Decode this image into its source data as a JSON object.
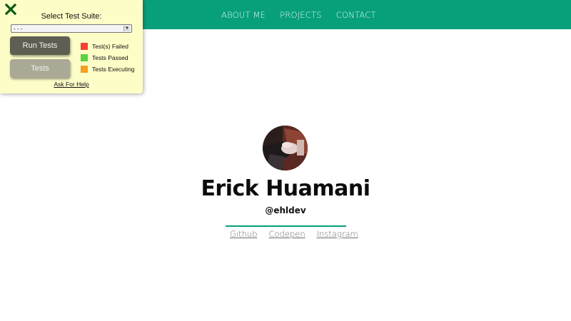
{
  "nav": {
    "links": [
      "ABOUT ME",
      "PROJECTS",
      "CONTACT"
    ]
  },
  "test_panel": {
    "title": "Select Test Suite:",
    "select_value": "- - -",
    "run_button": "Run Tests",
    "tests_button": "Tests",
    "legend": [
      {
        "label": "Test(s) Failed",
        "color": "#f44336"
      },
      {
        "label": "Tests Passed",
        "color": "#5ad23d"
      },
      {
        "label": "Tests Executing",
        "color": "#f5a01e"
      }
    ],
    "help_link": "Ask For Help",
    "close_icon": "close-x-icon"
  },
  "profile": {
    "name": "Erick Huamani",
    "handle": "@ehldev",
    "social": [
      "Github",
      "Codepen",
      "Instagram"
    ]
  },
  "colors": {
    "accent": "#07a07a",
    "panel_bg": "#fdfdc8"
  }
}
